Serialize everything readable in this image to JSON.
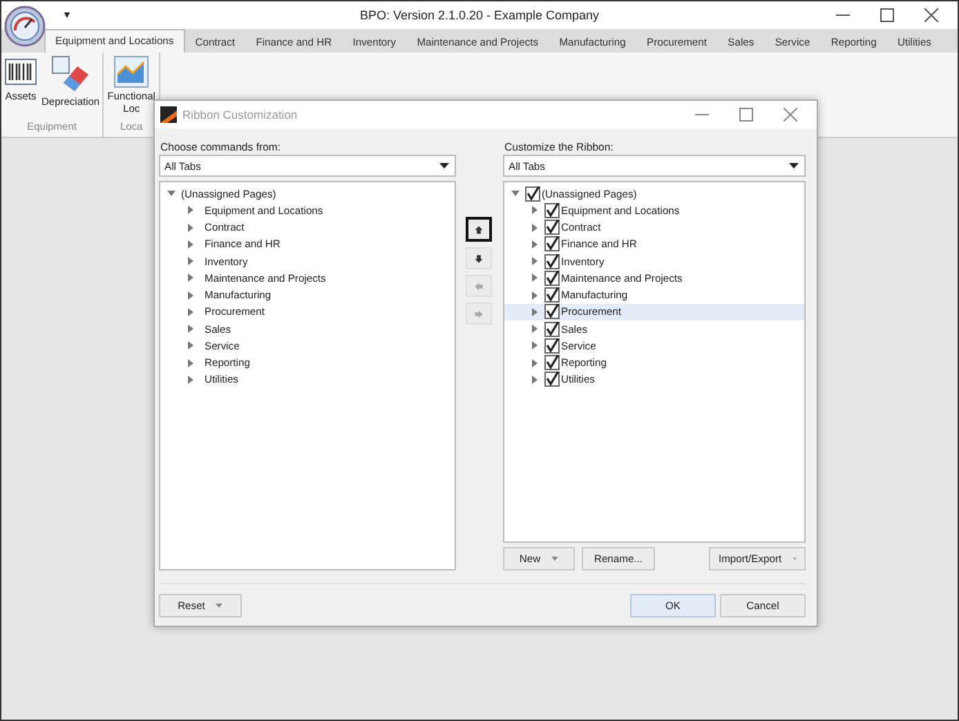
{
  "window": {
    "title": "BPO: Version 2.1.0.20 - Example Company",
    "quick_access": "▼"
  },
  "tabs": [
    {
      "label": "Equipment and Locations",
      "selected": true
    },
    {
      "label": "Contract",
      "selected": false
    },
    {
      "label": "Finance and HR",
      "selected": false
    },
    {
      "label": "Inventory",
      "selected": false
    },
    {
      "label": "Maintenance and Projects",
      "selected": false
    },
    {
      "label": "Manufacturing",
      "selected": false
    },
    {
      "label": "Procurement",
      "selected": false
    },
    {
      "label": "Sales",
      "selected": false
    },
    {
      "label": "Service",
      "selected": false
    },
    {
      "label": "Reporting",
      "selected": false
    },
    {
      "label": "Utilities",
      "selected": false
    }
  ],
  "ribbon_groups": [
    {
      "label": "Equipment",
      "buttons": [
        {
          "kind": "barcode",
          "label": "Assets"
        },
        {
          "kind": "eraser",
          "label": "Depreciation"
        }
      ]
    },
    {
      "label": "Loca",
      "buttons": [
        {
          "kind": "chart",
          "label": "Functional Loc"
        }
      ]
    }
  ],
  "dialog": {
    "title": "Ribbon Customization",
    "left": {
      "label": "Choose commands from:",
      "combo": "All Tabs",
      "tree": {
        "label": "(Unassigned Pages)",
        "expanded": true,
        "children": [
          {
            "label": "Equipment and Locations",
            "expanded": false
          },
          {
            "label": "Contract",
            "expanded": false
          },
          {
            "label": "Finance and HR",
            "expanded": false
          },
          {
            "label": "Inventory",
            "expanded": false
          },
          {
            "label": "Maintenance and Projects",
            "expanded": false
          },
          {
            "label": "Manufacturing",
            "expanded": false
          },
          {
            "label": "Procurement",
            "expanded": false
          },
          {
            "label": "Sales",
            "expanded": false
          },
          {
            "label": "Service",
            "expanded": false
          },
          {
            "label": "Reporting",
            "expanded": false
          },
          {
            "label": "Utilities",
            "expanded": false
          }
        ]
      }
    },
    "move_buttons": [
      {
        "kind": "up",
        "disabled": false,
        "focused": true
      },
      {
        "kind": "down",
        "disabled": false,
        "focused": false
      },
      {
        "kind": "left",
        "disabled": true,
        "focused": false
      },
      {
        "kind": "right",
        "disabled": true,
        "focused": false
      }
    ],
    "right": {
      "label": "Customize the Ribbon:",
      "combo": "All Tabs",
      "tree": {
        "label": "(Unassigned Pages)",
        "expanded": true,
        "checked": true,
        "selected": false,
        "children": [
          {
            "label": "Equipment and Locations",
            "expanded": false,
            "checked": true,
            "selected": false
          },
          {
            "label": "Contract",
            "expanded": false,
            "checked": true,
            "selected": false
          },
          {
            "label": "Finance and HR",
            "expanded": false,
            "checked": true,
            "selected": false
          },
          {
            "label": "Inventory",
            "expanded": false,
            "checked": true,
            "selected": false
          },
          {
            "label": "Maintenance and Projects",
            "expanded": false,
            "checked": true,
            "selected": false
          },
          {
            "label": "Manufacturing",
            "expanded": false,
            "checked": true,
            "selected": false
          },
          {
            "label": "Procurement",
            "expanded": false,
            "checked": true,
            "selected": true
          },
          {
            "label": "Sales",
            "expanded": false,
            "checked": true,
            "selected": false
          },
          {
            "label": "Service",
            "expanded": false,
            "checked": true,
            "selected": false
          },
          {
            "label": "Reporting",
            "expanded": false,
            "checked": true,
            "selected": false
          },
          {
            "label": "Utilities",
            "expanded": false,
            "checked": true,
            "selected": false
          }
        ]
      },
      "buttons": [
        {
          "label": "New",
          "dropdown": true
        },
        {
          "label": "Rename...",
          "dropdown": false
        },
        {
          "label": "Import/Export",
          "dropdown": true
        }
      ]
    },
    "reset": {
      "label": "Reset",
      "dropdown": true
    },
    "ok": "OK",
    "cancel": "Cancel"
  }
}
